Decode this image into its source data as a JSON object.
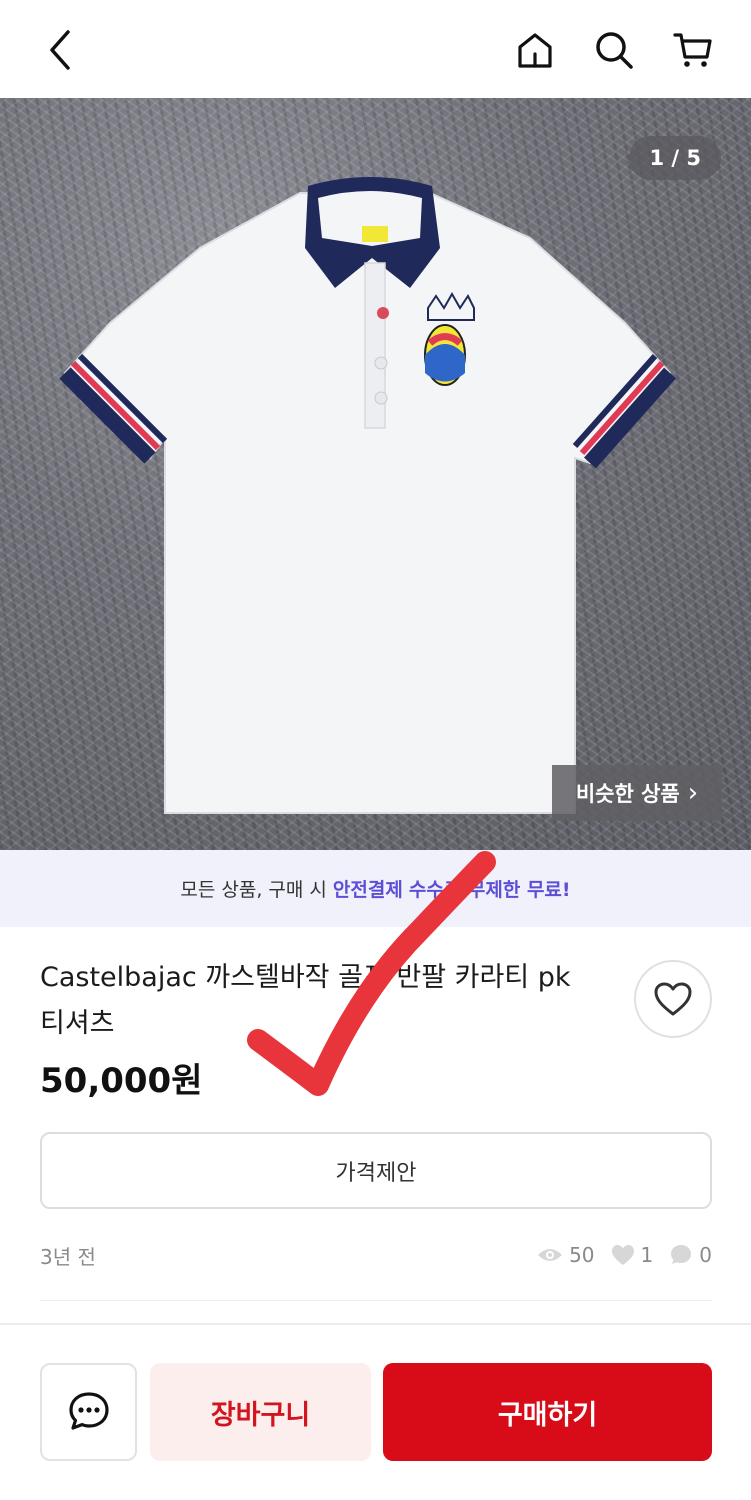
{
  "header": {
    "back_icon": "chevron-left-icon",
    "home_icon": "home-icon",
    "search_icon": "search-icon",
    "cart_icon": "cart-icon"
  },
  "gallery": {
    "counter": "1 / 5",
    "similar_button": "비슷한 상품",
    "similar_chevron": "›"
  },
  "banner": {
    "prefix": "모든 상품, 구매 시",
    "highlight": "안전결제",
    "suffix": "수수료 무제한 무료!"
  },
  "product": {
    "title": "Castelbajac 까스텔바작 골프 반팔 카라티 pk 티셔츠",
    "price": "50,000원"
  },
  "actions": {
    "offer_label": "가격제안",
    "cart_label": "장바구니",
    "buy_label": "구매하기"
  },
  "meta": {
    "time_ago": "3년 전",
    "views": "50",
    "likes": "1",
    "chats": "0"
  },
  "colors": {
    "accent_red": "#d80c18",
    "banner_highlight": "#5b4fd6",
    "banner_bg": "#f1f1fb"
  }
}
